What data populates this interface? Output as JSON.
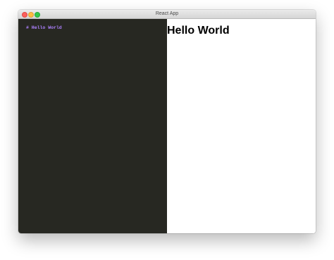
{
  "window": {
    "title": "React App"
  },
  "editor": {
    "line": "# Hello World",
    "background": "#272822",
    "text_color": "#ae81ff"
  },
  "preview": {
    "heading": "Hello World"
  }
}
